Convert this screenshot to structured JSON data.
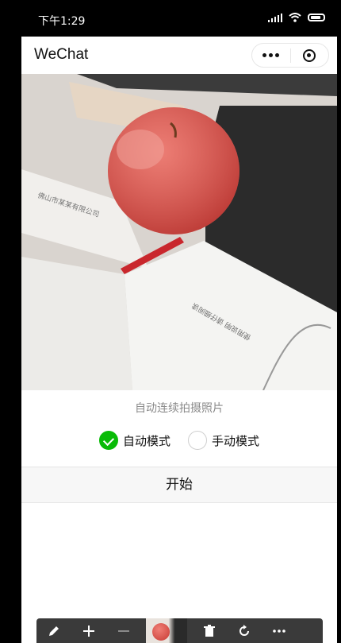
{
  "status_bar": {
    "time": "下午1:29"
  },
  "nav": {
    "title": "WeChat"
  },
  "camera": {
    "carton_text": "佛山市某某有限公司",
    "paper_text": "使用说明 请仔细阅读"
  },
  "hint": "自动连续拍摄照片",
  "modes": [
    {
      "label": "自动模式",
      "selected": true
    },
    {
      "label": "手动模式",
      "selected": false
    }
  ],
  "start_button": "开始",
  "colors": {
    "accent": "#09bb07",
    "toolbar": "#3a3a3a"
  },
  "toolbar_icons": [
    "edit-icon",
    "plus-icon",
    "minus-icon",
    "thumbnail",
    "trash-icon",
    "rotate-icon",
    "more-icon"
  ]
}
